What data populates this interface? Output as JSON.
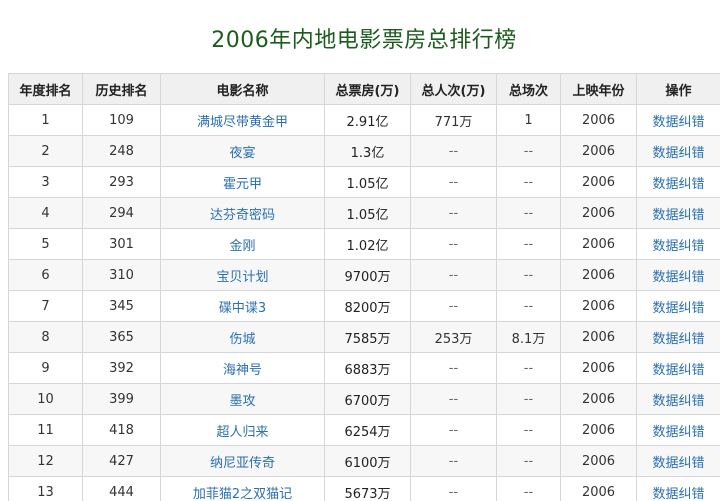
{
  "page": {
    "title": "2006年内地电影票房总排行榜"
  },
  "table": {
    "headers": [
      "年度排名",
      "历史排名",
      "电影名称",
      "总票房(万)",
      "总人次(万)",
      "总场次",
      "上映年份",
      "操作"
    ],
    "rows": [
      {
        "rank": "1",
        "hist": "109",
        "name": "满城尽带黄金甲",
        "gross": "2.91亿",
        "people": "771万",
        "shows": "1",
        "year": "2006",
        "op": "数据纠错"
      },
      {
        "rank": "2",
        "hist": "248",
        "name": "夜宴",
        "gross": "1.3亿",
        "people": "--",
        "shows": "--",
        "year": "2006",
        "op": "数据纠错"
      },
      {
        "rank": "3",
        "hist": "293",
        "name": "霍元甲",
        "gross": "1.05亿",
        "people": "--",
        "shows": "--",
        "year": "2006",
        "op": "数据纠错"
      },
      {
        "rank": "4",
        "hist": "294",
        "name": "达芬奇密码",
        "gross": "1.05亿",
        "people": "--",
        "shows": "--",
        "year": "2006",
        "op": "数据纠错"
      },
      {
        "rank": "5",
        "hist": "301",
        "name": "金刚",
        "gross": "1.02亿",
        "people": "--",
        "shows": "--",
        "year": "2006",
        "op": "数据纠错"
      },
      {
        "rank": "6",
        "hist": "310",
        "name": "宝贝计划",
        "gross": "9700万",
        "people": "--",
        "shows": "--",
        "year": "2006",
        "op": "数据纠错"
      },
      {
        "rank": "7",
        "hist": "345",
        "name": "碟中谍3",
        "gross": "8200万",
        "people": "--",
        "shows": "--",
        "year": "2006",
        "op": "数据纠错"
      },
      {
        "rank": "8",
        "hist": "365",
        "name": "伤城",
        "gross": "7585万",
        "people": "253万",
        "shows": "8.1万",
        "year": "2006",
        "op": "数据纠错"
      },
      {
        "rank": "9",
        "hist": "392",
        "name": "海神号",
        "gross": "6883万",
        "people": "--",
        "shows": "--",
        "year": "2006",
        "op": "数据纠错"
      },
      {
        "rank": "10",
        "hist": "399",
        "name": "墨攻",
        "gross": "6700万",
        "people": "--",
        "shows": "--",
        "year": "2006",
        "op": "数据纠错"
      },
      {
        "rank": "11",
        "hist": "418",
        "name": "超人归来",
        "gross": "6254万",
        "people": "--",
        "shows": "--",
        "year": "2006",
        "op": "数据纠错"
      },
      {
        "rank": "12",
        "hist": "427",
        "name": "纳尼亚传奇",
        "gross": "6100万",
        "people": "--",
        "shows": "--",
        "year": "2006",
        "op": "数据纠错"
      },
      {
        "rank": "13",
        "hist": "444",
        "name": "加菲猫2之双猫记",
        "gross": "5673万",
        "people": "--",
        "shows": "--",
        "year": "2006",
        "op": "数据纠错"
      }
    ]
  },
  "colors": {
    "title": "#1c5c1c",
    "link": "#2a6fb3",
    "header_bg": "#f0f0f0",
    "border": "#d6d6d6"
  }
}
